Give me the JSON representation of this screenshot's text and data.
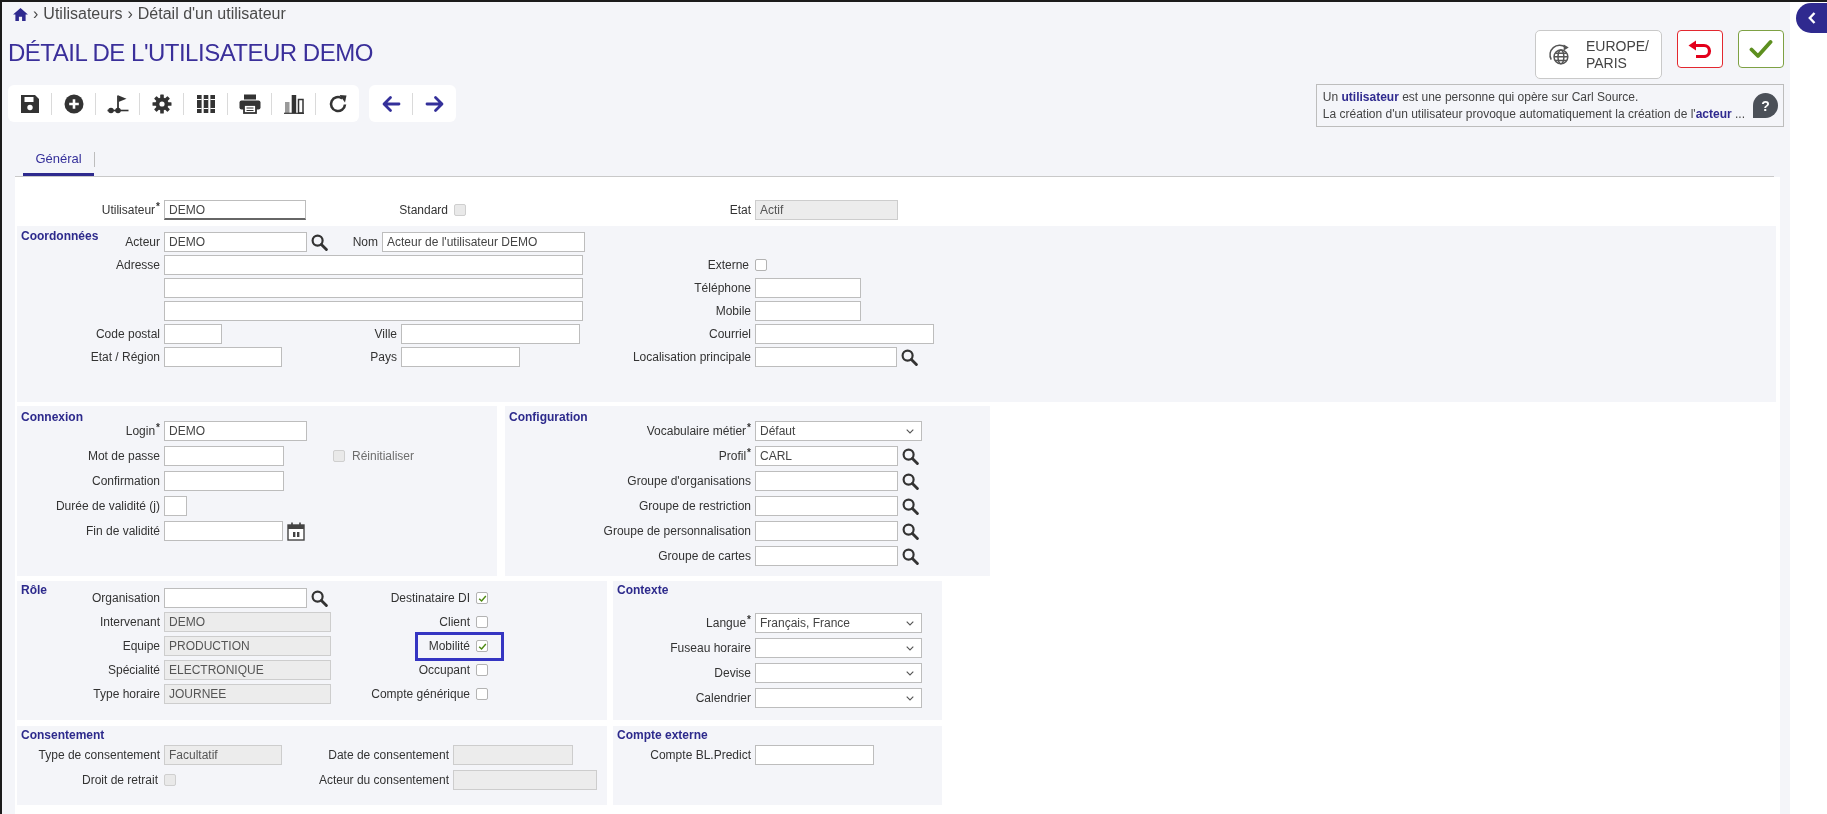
{
  "breadcrumb": [
    {
      "separator": "›",
      "label": "Utilisateurs"
    },
    {
      "separator": "›",
      "label": "Détail d'un utilisateur"
    }
  ],
  "title": "DÉTAIL DE L'UTILISATEUR DEMO",
  "timezone_button": "EUROPE/\nPARIS",
  "info": {
    "text": "Un **utilisateur** est une personne qui opère sur Carl Source.\nLa création d'un utilisateur provoque automatiquement la création de l'**acteur** ...",
    "help": "?"
  },
  "tabs": [
    {
      "label": "Général",
      "selected": true
    }
  ],
  "header_fields": [
    {
      "kind": "text",
      "label": "Utilisateur$^{*}$",
      "value": "DEMO",
      "disabled": false,
      "focused": true
    },
    {
      "kind": "checkbox",
      "label": "Standard",
      "checked": false,
      "disabled": true,
      "highlighted": false
    },
    {
      "kind": "text",
      "label": "Etat",
      "value": "Actif",
      "disabled": true,
      "focused": false
    }
  ],
  "sections": [
    {
      "title": "Coordonnées",
      "fields": [
        {
          "kind": "text",
          "label": "Acteur",
          "value": "DEMO",
          "disabled": false,
          "focused": false,
          "lookup": true
        },
        {
          "kind": "text",
          "label": "Nom",
          "value": "Acteur de l'utilisateur DEMO",
          "disabled": false,
          "focused": false
        },
        {
          "kind": "text",
          "label": "Adresse",
          "disabled": false,
          "focused": false
        },
        {
          "kind": "checkbox",
          "label": "Externe",
          "checked": false,
          "disabled": false,
          "highlighted": false
        },
        {
          "kind": "text",
          "disabled": false,
          "focused": false
        },
        {
          "kind": "text",
          "label": "Téléphone",
          "disabled": false,
          "focused": false
        },
        {
          "kind": "text",
          "disabled": false,
          "focused": false
        },
        {
          "kind": "text",
          "label": "Mobile",
          "disabled": false,
          "focused": false
        },
        {
          "kind": "text",
          "label": "Code postal",
          "disabled": false,
          "focused": false
        },
        {
          "kind": "text",
          "label": "Ville",
          "disabled": false,
          "focused": false
        },
        {
          "kind": "text",
          "label": "Courriel",
          "disabled": false,
          "focused": false
        },
        {
          "kind": "text",
          "label": "Etat / Région",
          "disabled": false,
          "focused": false
        },
        {
          "kind": "text",
          "label": "Pays",
          "disabled": false,
          "focused": false
        },
        {
          "kind": "text",
          "label": "Localisation principale",
          "disabled": false,
          "focused": false,
          "lookup": true
        }
      ]
    },
    {
      "title": "Connexion",
      "fields": [
        {
          "kind": "text",
          "label": "Login$^{*}$",
          "value": "DEMO",
          "disabled": false,
          "focused": false
        },
        {
          "kind": "text",
          "label": "Mot de passe",
          "disabled": false,
          "focused": false
        },
        {
          "kind": "checkbox",
          "label": "Réinitialiser",
          "checked": false,
          "disabled": true,
          "highlighted": false
        },
        {
          "kind": "text",
          "label": "Confirmation",
          "disabled": false,
          "focused": false
        },
        {
          "kind": "text",
          "label": "Durée de validité (j)",
          "disabled": false,
          "focused": false
        },
        {
          "kind": "text",
          "label": "Fin de validité",
          "disabled": false,
          "focused": false,
          "calendar": true
        }
      ]
    },
    {
      "title": "Configuration",
      "fields": [
        {
          "kind": "select",
          "label": "Vocabulaire métier$^{*}$",
          "value": "Défaut",
          "disabled": false
        },
        {
          "kind": "text",
          "label": "Profil$^{*}$",
          "value": "CARL",
          "disabled": false,
          "focused": false,
          "lookup": true
        },
        {
          "kind": "text",
          "label": "Groupe d'organisations",
          "disabled": false,
          "focused": false,
          "lookup": true
        },
        {
          "kind": "text",
          "label": "Groupe de restriction",
          "disabled": false,
          "focused": false,
          "lookup": true
        },
        {
          "kind": "text",
          "label": "Groupe de personnalisation",
          "disabled": false,
          "focused": false,
          "lookup": true
        },
        {
          "kind": "text",
          "label": "Groupe de cartes",
          "disabled": false,
          "focused": false,
          "lookup": true
        }
      ]
    },
    {
      "title": "Rôle",
      "fields": [
        {
          "kind": "text",
          "label": "Organisation",
          "disabled": false,
          "focused": false,
          "lookup": true
        },
        {
          "kind": "checkbox",
          "label": "Destinataire DI",
          "checked": true,
          "disabled": false,
          "highlighted": false
        },
        {
          "kind": "text",
          "label": "Intervenant",
          "value": "DEMO",
          "disabled": true,
          "focused": false
        },
        {
          "kind": "checkbox",
          "label": "Client",
          "checked": false,
          "disabled": false,
          "highlighted": false
        },
        {
          "kind": "text",
          "label": "Equipe",
          "value": "PRODUCTION",
          "disabled": true,
          "focused": false
        },
        {
          "kind": "checkbox",
          "label": "Mobilité",
          "checked": true,
          "disabled": false,
          "highlighted": true
        },
        {
          "kind": "text",
          "label": "Spécialité",
          "value": "ELECTRONIQUE",
          "disabled": true,
          "focused": false
        },
        {
          "kind": "checkbox",
          "label": "Occupant",
          "checked": false,
          "disabled": false,
          "highlighted": false
        },
        {
          "kind": "text",
          "label": "Type horaire",
          "value": "JOURNEE",
          "disabled": true,
          "focused": false
        },
        {
          "kind": "checkbox",
          "label": "Compte générique",
          "checked": false,
          "disabled": false,
          "highlighted": false
        }
      ]
    },
    {
      "title": "Contexte",
      "fields": [
        {
          "kind": "select",
          "label": "Langue$^{*}$",
          "value": "Français, France",
          "disabled": false
        },
        {
          "kind": "select",
          "label": "Fuseau horaire",
          "disabled": false
        },
        {
          "kind": "select",
          "label": "Devise",
          "disabled": false
        },
        {
          "kind": "select",
          "label": "Calendrier",
          "disabled": false
        }
      ]
    },
    {
      "title": "Consentement",
      "fields": [
        {
          "kind": "text",
          "label": "Type de consentement",
          "value": "Facultatif",
          "disabled": true,
          "focused": false
        },
        {
          "kind": "text",
          "label": "Date de consentement",
          "disabled": true,
          "focused": false
        },
        {
          "kind": "checkbox",
          "label": "Droit de retrait",
          "checked": false,
          "disabled": true,
          "highlighted": false
        },
        {
          "kind": "text",
          "label": "Acteur du consentement",
          "disabled": true,
          "focused": false
        }
      ]
    },
    {
      "title": "Compte externe",
      "fields": [
        {
          "kind": "text",
          "label": "Compte BL.Predict",
          "disabled": false,
          "focused": false
        }
      ]
    }
  ]
}
